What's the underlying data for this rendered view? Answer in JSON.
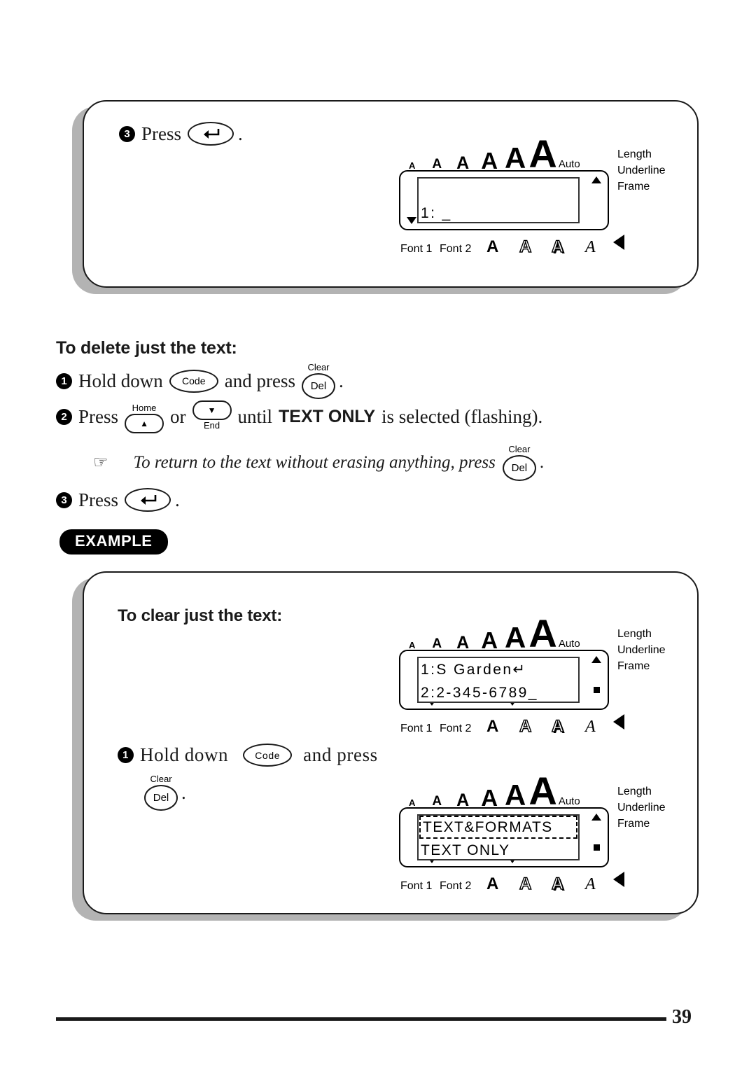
{
  "page": {
    "number": "39"
  },
  "panel_top": {
    "step": {
      "marker": "3",
      "press_label": "Press",
      "key": {
        "name": "enter-key",
        "glyph": "↵"
      },
      "period": "."
    },
    "lcd": {
      "size_indicators": [
        "A",
        "A",
        "A",
        "A",
        "A",
        "A"
      ],
      "auto_label": "Auto",
      "line1": "",
      "line2": "1: _",
      "side_labels": [
        "Length",
        "Underline",
        "Frame"
      ],
      "font_labels": [
        "Font 1",
        "Font 2"
      ],
      "style_glyphs": [
        "A",
        "A",
        "A",
        "A"
      ],
      "tail_glyph": "left-triangle"
    }
  },
  "section_delete": {
    "heading": "To delete just the text:",
    "steps": [
      {
        "marker": "1",
        "text_before": "Hold down",
        "key1": {
          "label": "Code",
          "name": "code-key"
        },
        "text_mid": "and press",
        "key2": {
          "top_label": "Clear",
          "label": "Del",
          "name": "del-key"
        },
        "text_after": "."
      },
      {
        "marker": "2",
        "text_before": "Press",
        "key1": {
          "top_label": "Home",
          "glyph": "▲",
          "name": "home-up-key"
        },
        "text_mid": "or",
        "key2": {
          "bottom_label": "End",
          "glyph": "▼",
          "name": "end-down-key"
        },
        "text_after_1": "until",
        "bold_term": "TEXT ONLY",
        "text_after_2": "is selected (flashing)."
      },
      {
        "marker": "3",
        "text_before": "Press",
        "key1": {
          "glyph": "↵",
          "name": "enter-key"
        },
        "text_after": "."
      }
    ],
    "note": {
      "icon": "pointing-hand-icon",
      "icon_glyph": "☞",
      "text_before": "To return to the text without erasing anything, press",
      "key": {
        "top_label": "Clear",
        "label": "Del",
        "name": "del-key"
      },
      "text_after": "."
    }
  },
  "example": {
    "badge": "EXAMPLE",
    "heading": "To clear just the text:",
    "lcd_before": {
      "size_indicators": [
        "A",
        "A",
        "A",
        "A",
        "A",
        "A"
      ],
      "auto_label": "Auto",
      "line1": "1:S Garden↵",
      "line2": "2:2-345-6789_",
      "side_labels": [
        "Length",
        "Underline",
        "Frame"
      ],
      "font_labels": [
        "Font 1",
        "Font 2"
      ],
      "style_glyphs": [
        "A",
        "A",
        "A",
        "A"
      ],
      "tail_glyph": "left-triangle"
    },
    "step": {
      "marker": "1",
      "text_before": "Hold down",
      "key1": {
        "label": "Code",
        "name": "code-key"
      },
      "text_mid": "and press",
      "key2": {
        "top_label": "Clear",
        "label": "Del",
        "name": "del-key"
      },
      "text_after": "."
    },
    "lcd_after": {
      "size_indicators": [
        "A",
        "A",
        "A",
        "A",
        "A",
        "A"
      ],
      "auto_label": "Auto",
      "line1": "TEXT&FORMATS",
      "line2": "TEXT ONLY",
      "side_labels": [
        "Length",
        "Underline",
        "Frame"
      ],
      "font_labels": [
        "Font 1",
        "Font 2"
      ],
      "style_glyphs": [
        "A",
        "A",
        "A",
        "A"
      ],
      "tail_glyph": "left-triangle"
    }
  }
}
